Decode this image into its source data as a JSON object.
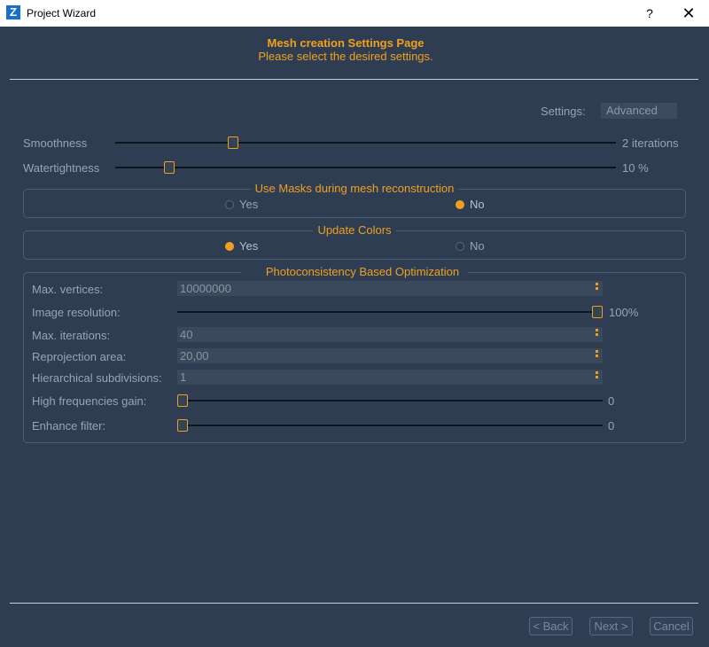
{
  "window": {
    "title": "Project Wizard",
    "logo": "Z",
    "help": "?",
    "close": "✕"
  },
  "header": {
    "title": "Mesh creation Settings Page",
    "subtitle": "Please select the desired settings."
  },
  "settings": {
    "label": "Settings:",
    "value": "Advanced"
  },
  "smoothness": {
    "label": "Smoothness",
    "value_text": "2 iterations",
    "level": 0.23
  },
  "watertightness": {
    "label": "Watertightness",
    "value_text": "10 %",
    "level": 0.1
  },
  "masks": {
    "title": "Use Masks during mesh reconstruction",
    "yes": "Yes",
    "no": "No",
    "selected": "No"
  },
  "colors": {
    "title": "Update Colors",
    "yes": "Yes",
    "no": "No",
    "selected": "Yes"
  },
  "photo": {
    "title": "Photoconsistency Based Optimization",
    "checked": true,
    "max_vertices": {
      "label": "Max. vertices:",
      "value": "10000000"
    },
    "image_resolution": {
      "label": "Image resolution:",
      "value_text": "100%",
      "level": 1.0
    },
    "max_iterations": {
      "label": "Max. iterations:",
      "value": "40"
    },
    "reprojection_area": {
      "label": "Reprojection area:",
      "value": "20,00"
    },
    "hierarchical": {
      "label": "Hierarchical subdivisions:",
      "value": "1"
    },
    "hf_gain": {
      "label": "High frequencies gain:",
      "value_text": "0",
      "level": 0.0
    },
    "enhance": {
      "label": "Enhance filter:",
      "value_text": "0",
      "level": 0.0
    }
  },
  "buttons": {
    "back": "< Back",
    "next": "Next >",
    "cancel": "Cancel"
  },
  "colors_theme": {
    "accent": "#f0a020",
    "background": "#2f3d52",
    "text": "#9aa4b1"
  }
}
